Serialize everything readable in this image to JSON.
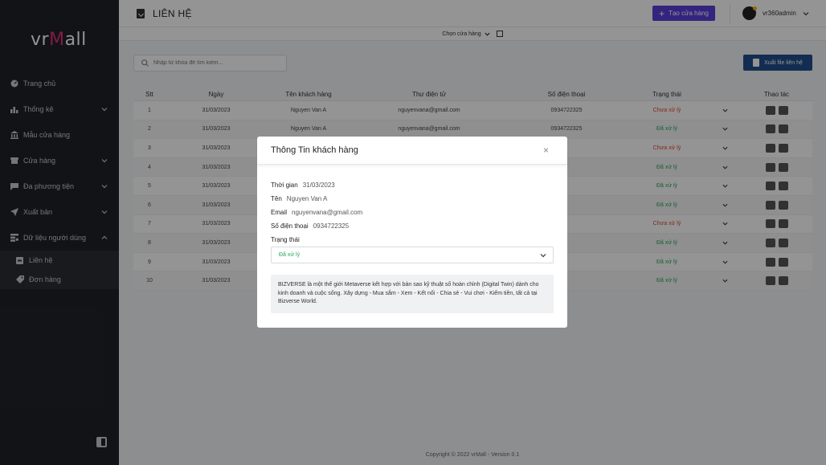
{
  "sidebar": {
    "logo": {
      "prefix": "vr",
      "m": "M",
      "suffix": "all"
    },
    "items": [
      {
        "label": "Trang chủ",
        "icon": "speedometer-icon",
        "has_chevron": false
      },
      {
        "label": "Thống kê",
        "icon": "bar-chart-icon",
        "has_chevron": true
      },
      {
        "label": "Mẫu cửa hàng",
        "icon": "bank-icon",
        "has_chevron": false
      },
      {
        "label": "Cửa hàng",
        "icon": "store-icon",
        "has_chevron": true
      },
      {
        "label": "Đa phương tiện",
        "icon": "chat-icon",
        "has_chevron": true
      },
      {
        "label": "Xuất bản",
        "icon": "send-icon",
        "has_chevron": true
      },
      {
        "label": "Dữ liệu người dùng",
        "icon": "database-icon",
        "has_chevron": true
      }
    ],
    "subitems": [
      {
        "label": "Liên hệ",
        "icon": "contact-icon"
      },
      {
        "label": "Đơn hàng",
        "icon": "tag-icon"
      }
    ]
  },
  "header": {
    "title": "LIÊN HỆ",
    "create_label": "Tạo cửa hàng",
    "username": "vr360admin"
  },
  "subheader": {
    "store_select": "Chọn cửa hàng"
  },
  "search": {
    "placeholder": "Nhập từ khóa để tìm kiếm..."
  },
  "export_label": "Xuất file liên hệ",
  "table": {
    "headers": {
      "stt": "Stt",
      "date": "Ngày",
      "name": "Tên khách hàng",
      "email": "Thư điện tử",
      "phone": "Số điện thoại",
      "status": "Trạng thái",
      "actions": "Thao tác"
    },
    "rows": [
      {
        "stt": "1",
        "date": "31/03/2023",
        "name": "Nguyen Van A",
        "email": "nguyenvana@gmail.com",
        "phone": "0934722325",
        "status": "Chưa xử lý"
      },
      {
        "stt": "2",
        "date": "31/03/2023",
        "name": "Nguyen Van A",
        "email": "nguyenvana@gmail.com",
        "phone": "0934722325",
        "status": "Đã xử lý"
      },
      {
        "stt": "3",
        "date": "31/03/2023",
        "name": "",
        "email": "",
        "phone": "",
        "status": "Chưa xử lý"
      },
      {
        "stt": "4",
        "date": "31/03/2023",
        "name": "",
        "email": "",
        "phone": "",
        "status": "Đã xử lý"
      },
      {
        "stt": "5",
        "date": "31/03/2023",
        "name": "",
        "email": "",
        "phone": "",
        "status": "Đã xử lý"
      },
      {
        "stt": "6",
        "date": "31/03/2023",
        "name": "",
        "email": "",
        "phone": "",
        "status": "Đã xử lý"
      },
      {
        "stt": "7",
        "date": "31/03/2023",
        "name": "",
        "email": "",
        "phone": "",
        "status": "Chưa xử lý"
      },
      {
        "stt": "8",
        "date": "31/03/2023",
        "name": "",
        "email": "",
        "phone": "",
        "status": "Đã xử lý"
      },
      {
        "stt": "9",
        "date": "31/03/2023",
        "name": "",
        "email": "",
        "phone": "",
        "status": "Đã xử lý"
      },
      {
        "stt": "10",
        "date": "31/03/2023",
        "name": "",
        "email": "",
        "phone": "",
        "status": "Đã xử lý"
      }
    ]
  },
  "footer": "Copyright © 2022 vrMall - Version 0.1",
  "modal": {
    "title": "Thông Tin khách hàng",
    "close": "×",
    "fields": {
      "time_label": "Thời gian",
      "time": "31/03/2023",
      "name_label": "Tên",
      "name": "Nguyen Van A",
      "email_label": "Email",
      "email": "nguyenvana@gmail.com",
      "phone_label": "Số điện thoại",
      "phone": "0934722325",
      "status_label": "Trạng thái"
    },
    "status_value": "Đã xử lý",
    "note": "BIZVERSE là một thế giới Metaverse kết hợp với bản sao kỹ thuật số hoàn chỉnh (Digital Twin) dành cho kinh doanh và cuộc sống. Xây dựng - Mua sắm - Xem - Kết nối - Chia sẻ - Vui chơi - Kiếm tiền, tất cả tại Bizverse World."
  },
  "colors": {
    "pending": "#e0452f",
    "done": "#2aa55a",
    "primary": "#5a3fd9",
    "export": "#1f4e8c",
    "sidebar": "#1f2228"
  }
}
